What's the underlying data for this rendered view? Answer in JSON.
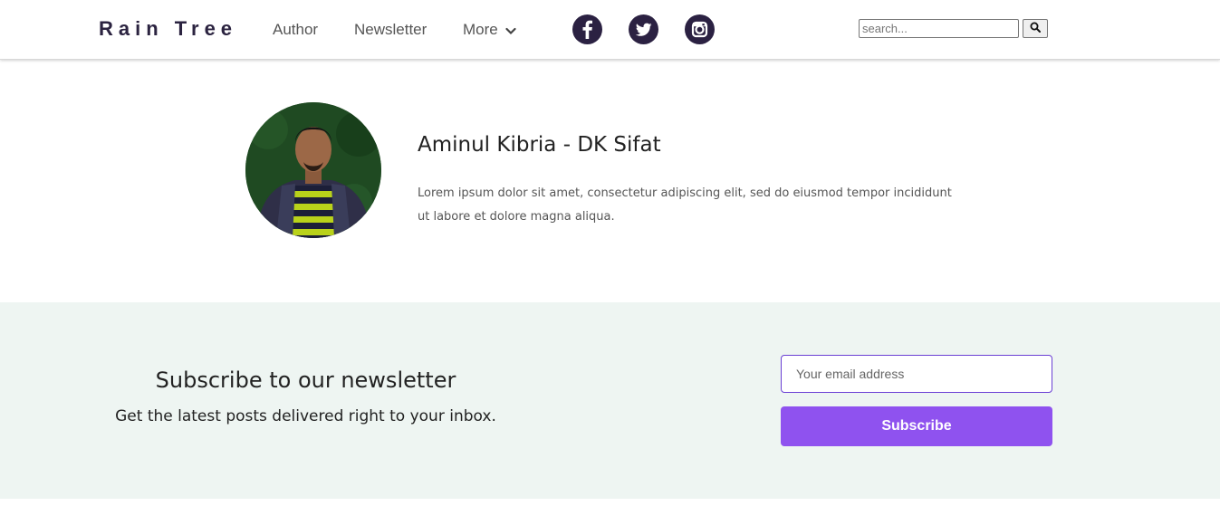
{
  "header": {
    "brand": "Rain Tree",
    "nav": {
      "author": "Author",
      "newsletter": "Newsletter",
      "more": "More"
    },
    "social": [
      "facebook-icon",
      "twitter-icon",
      "instagram-icon"
    ],
    "search": {
      "placeholder": "search...",
      "button_icon": "search-icon"
    }
  },
  "author": {
    "name": "Aminul Kibria - DK Sifat",
    "bio": "Lorem ipsum dolor sit amet, consectetur adipiscing elit, sed do eiusmod tempor incididunt ut labore et dolore magna aliqua."
  },
  "newsletter": {
    "title": "Subscribe to our newsletter",
    "subtitle": "Get the latest posts delivered right to your inbox.",
    "email_placeholder": "Your email address",
    "button_label": "Subscribe"
  },
  "colors": {
    "brand_dark": "#2b2142",
    "newsletter_bg": "#eef5f2",
    "accent": "#8f52ef",
    "input_border": "#6a3fd4"
  }
}
